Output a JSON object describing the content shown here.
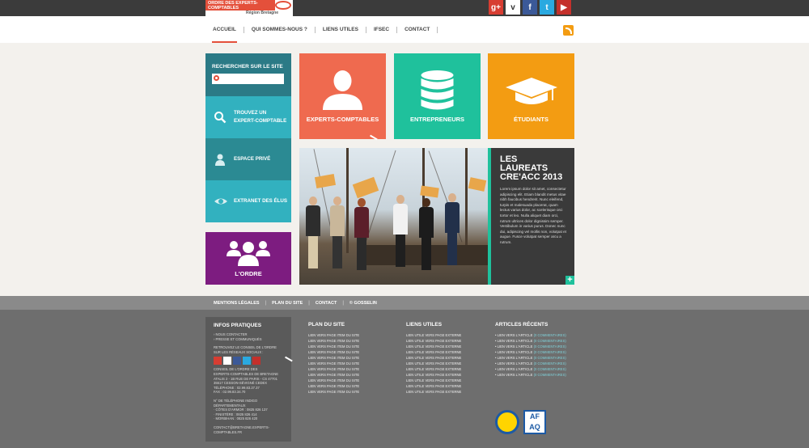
{
  "logo": {
    "line": "ORDRE DES EXPERTS-COMPTABLES",
    "region": "Région Bretagne"
  },
  "social": [
    {
      "icon": "google-plus-icon",
      "glyph": "g+"
    },
    {
      "icon": "vimeo-icon",
      "glyph": "v"
    },
    {
      "icon": "facebook-icon",
      "glyph": "f"
    },
    {
      "icon": "twitter-icon",
      "glyph": "t"
    },
    {
      "icon": "youtube-icon",
      "glyph": "▶"
    }
  ],
  "nav": {
    "items": [
      "ACCUEIL",
      "QUI SOMMES-NOUS ?",
      "LIENS UTILES",
      "IFSEC",
      "CONTACT"
    ],
    "active": "ACCUEIL",
    "accent": "#e4503b"
  },
  "search": {
    "label": "RECHERCHER SUR LE SITE",
    "placeholder": ""
  },
  "side_tiles": [
    {
      "label": "TROUVEZ UN EXPERT-COMPTABLE",
      "icon": "search-icon"
    },
    {
      "label": "ESPACE PRIVÉ",
      "icon": "user-icon"
    },
    {
      "label": "EXTRANET DES ÉLUS",
      "icon": "eye-icon"
    }
  ],
  "ordre": {
    "label": "L'ORDRE",
    "icon": "group-icon",
    "color": "#7d1c80"
  },
  "tiles": [
    {
      "label": "EXPERTS-COMPTABLES",
      "icon": "person-icon",
      "color": "#ef6a4f"
    },
    {
      "label": "ENTREPRENEURS",
      "icon": "database-icon",
      "color": "#1fc19c"
    },
    {
      "label": "ÉTUDIANTS",
      "icon": "graduation-cap-icon",
      "color": "#f39c12"
    }
  ],
  "news": {
    "title": "LES LAUREATS CRE'ACC 2013",
    "body": "Lorem ipsum dolor sit amet, consectetur adipiscing elit. Etiam blandit metus vitae nibh faucibus hendrerit. Nunc eleifend, turpis et malesuada placerat, quam lectus varius dolor, ac scelerisque orci tortor et leo. Nulla aliquet diam orci, rutrum ultrices dolor dignissim semper. Vestibulum in varius purus. Donec nunc dui, adipiscing vel mollis non, volutpat et augue. Fusce volutpat semper arcu a rutrum.",
    "more": "+"
  },
  "footer_links": [
    "MENTIONS LÉGALES",
    "PLAN DU SITE",
    "CONTACT",
    "© GOSSELIN"
  ],
  "infos": {
    "title": "INFOS PRATIQUES",
    "links": [
      "› NOUS CONTACTER",
      "› PRESSE ET COMMUNIQUÉS"
    ],
    "social_label": [
      "RETROUVEZ LE CONSEIL DE L'ORDRE",
      "SUR LES RÉSEAUX SOCIAUX :"
    ],
    "address": [
      "CONSEIL DE L'ORDRE DES",
      "EXPERTS-COMPTABLES DE BRETAGNE",
      "ATALIS 2 - 1B RUE DE PARIS - CS 47701",
      "35517 CESSON-SÉVIGNÉ CEDEX",
      "TÉLÉPHONE : 02.99.83.27.37",
      "FAX : 02.99.83.34.70"
    ],
    "phones_title": "N° DE TÉLÉPHONE INDIGO DÉPARTEMENTAUX",
    "phones": [
      "· CÔTES D'ARMOR : 0825 826 137",
      "· FINISTÈRE : 0825 826 414",
      "· MORBIHAN : 0825 826 420"
    ],
    "email": "CONTACT@BRETAGNE.EXPERTS-COMPTABLES.FR"
  },
  "plan": {
    "title": "PLAN DU SITE",
    "links": [
      "LIEN VERS PAGE ITEM DU SITE",
      "LIEN VERS PAGE ITEM DU SITE",
      "LIEN VERS PAGE ITEM DU SITE",
      "LIEN VERS PAGE ITEM DU SITE",
      "LIEN VERS PAGE ITEM DU SITE",
      "LIEN VERS PAGE ITEM DU SITE",
      "LIEN VERS PAGE ITEM DU SITE",
      "LIEN VERS PAGE ITEM DU SITE",
      "LIEN VERS PAGE ITEM DU SITE",
      "LIEN VERS PAGE ITEM DU SITE",
      "LIEN VERS PAGE ITEM DU SITE"
    ]
  },
  "liens": {
    "title": "LIENS UTILES",
    "links": [
      "LIEN UTILE VERS PAGE EXTERNE",
      "LIEN UTILE VERS PAGE EXTERNE",
      "LIEN UTILE VERS PAGE EXTERNE",
      "LIEN UTILE VERS PAGE EXTERNE",
      "LIEN UTILE VERS PAGE EXTERNE",
      "LIEN UTILE VERS PAGE EXTERNE",
      "LIEN UTILE VERS PAGE EXTERNE",
      "LIEN UTILE VERS PAGE EXTERNE",
      "LIEN UTILE VERS PAGE EXTERNE",
      "LIEN UTILE VERS PAGE EXTERNE",
      "LIEN UTILE VERS PAGE EXTERNE"
    ]
  },
  "articles": {
    "title": "ARTICLES RÉCENTS",
    "link": "LIEN VERS L'ARTICLE",
    "comments": "(0 COMMENTAIRES)",
    "count": 8
  }
}
